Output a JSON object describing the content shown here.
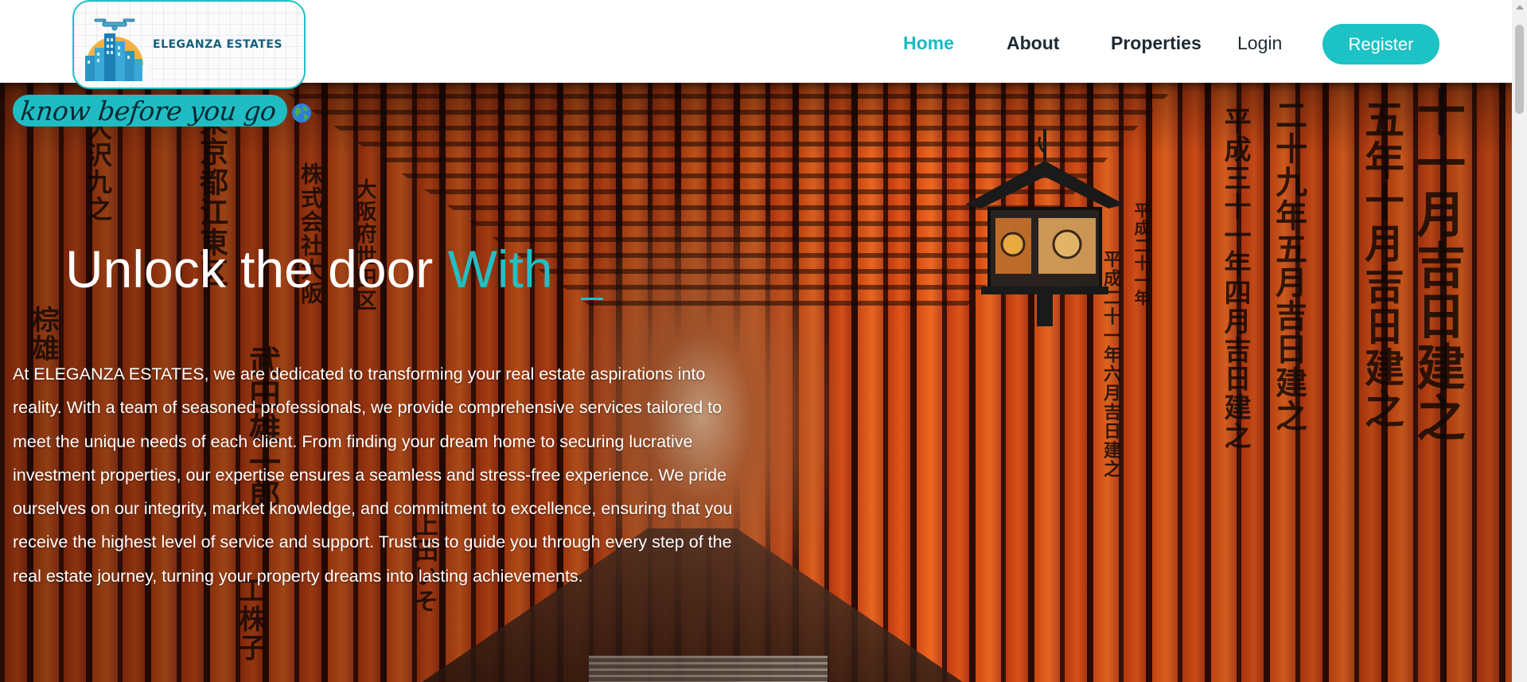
{
  "brand": {
    "name": "ELEGANZA ESTATES",
    "accent_color": "#1cc2c4",
    "text_color": "#155f7c",
    "logo_icon": "drone-city-buildings-icon"
  },
  "nav": {
    "items": [
      {
        "label": "Home",
        "active": true
      },
      {
        "label": "About",
        "active": false
      },
      {
        "label": "Properties",
        "active": false
      }
    ],
    "login_label": "Login",
    "register_label": "Register"
  },
  "hero": {
    "tagline": "know before you go",
    "tagline_icon": "globe-icon",
    "headline_main": "Unlock the door ",
    "headline_accent": "With",
    "description": "At ELEGANZA ESTATES, we are dedicated to transforming your real estate aspirations into reality. With a team of seasoned professionals, we provide comprehensive services tailored to meet the unique needs of each client. From finding your dream home to securing lucrative investment properties, our expertise ensures a seamless and stress-free experience. We pride ourselves on our integrity, market knowledge, and commitment to excellence, ensuring that you receive the highest level of service and support. Trust us to guide you through every step of the real estate journey, turning your property dreams into lasting achievements.",
    "background": "torii-gate-tunnel-photo"
  }
}
